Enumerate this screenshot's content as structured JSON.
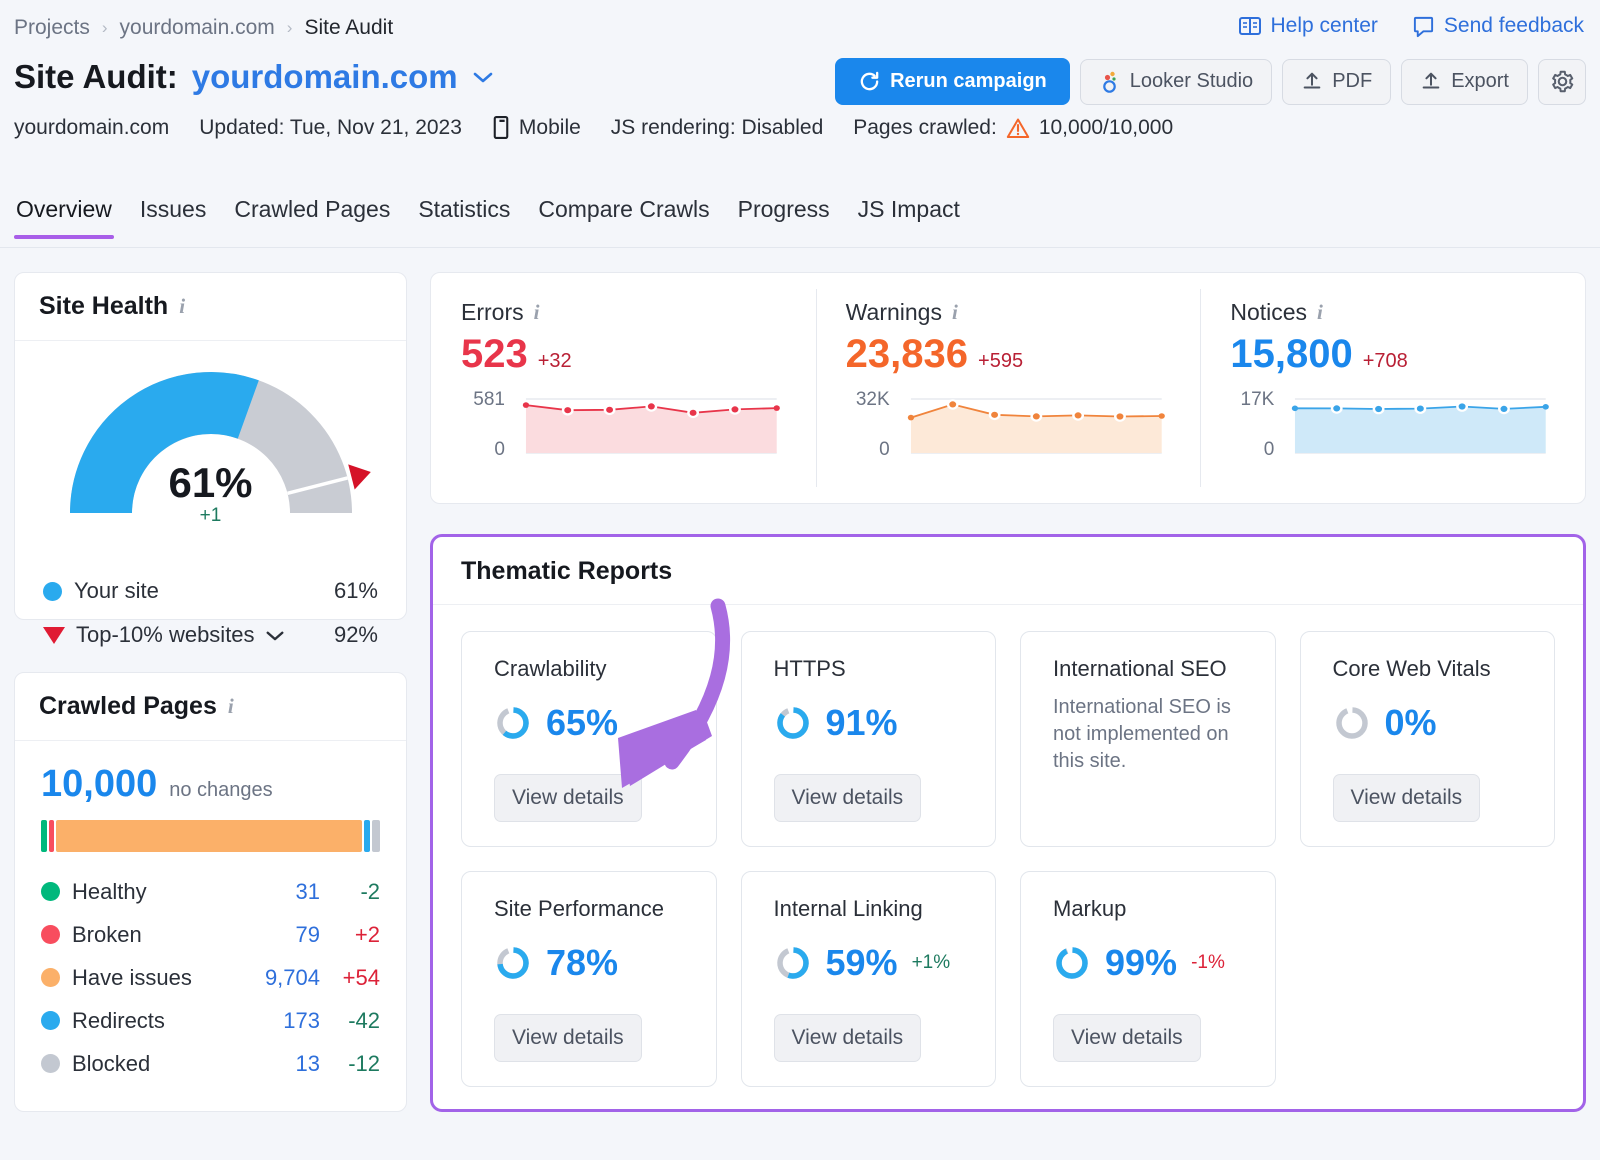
{
  "breadcrumb": {
    "items": [
      {
        "label": "Projects"
      },
      {
        "label": "yourdomain.com"
      },
      {
        "label": "Site Audit"
      }
    ],
    "separator": "›"
  },
  "top_links": [
    {
      "label": "Help center",
      "icon": "book-icon"
    },
    {
      "label": "Send feedback",
      "icon": "comment-icon"
    }
  ],
  "header": {
    "title_prefix": "Site Audit:",
    "domain": "yourdomain.com",
    "caret": "⌄"
  },
  "toolbar": {
    "rerun_label": "Rerun campaign",
    "looker_label": "Looker Studio",
    "pdf_label": "PDF",
    "export_label": "Export",
    "settings_icon": "gear-icon"
  },
  "meta": {
    "domain": "yourdomain.com",
    "updated": "Updated: Tue, Nov 21, 2023",
    "device": "Mobile",
    "js_rendering": "JS rendering: Disabled",
    "pages_crawled_label": "Pages crawled:",
    "pages_crawled_value": "10,000/10,000"
  },
  "tabs": [
    {
      "label": "Overview",
      "active": true
    },
    {
      "label": "Issues",
      "active": false
    },
    {
      "label": "Crawled Pages",
      "active": false
    },
    {
      "label": "Statistics",
      "active": false
    },
    {
      "label": "Compare Crawls",
      "active": false
    },
    {
      "label": "Progress",
      "active": false
    },
    {
      "label": "JS Impact",
      "active": false
    }
  ],
  "site_health": {
    "title": "Site Health",
    "info": "i",
    "value": "61%",
    "delta": "+1",
    "legend": [
      {
        "label": "Your site",
        "value": "61%",
        "marker": "dot",
        "color": "#2aaaee"
      },
      {
        "label": "Top-10% websites",
        "value": "92%",
        "marker": "triangle",
        "color": "#e01b33",
        "caret": "⌄"
      }
    ]
  },
  "crawled_pages": {
    "title": "Crawled Pages",
    "info": "i",
    "total": "10,000",
    "change_text": "no changes",
    "segments": [
      {
        "name": "Healthy",
        "color": "#00b87c",
        "pct": 1.6
      },
      {
        "name": "Broken",
        "color": "#f84d5e",
        "pct": 1.6
      },
      {
        "name": "Have issues",
        "color": "#fbb069",
        "pct": 87.8
      },
      {
        "name": "Redirects",
        "color": "#2aaaee",
        "pct": 1.8
      },
      {
        "name": "Blocked",
        "color": "#c3c8d1",
        "pct": 2.2
      }
    ],
    "rows": [
      {
        "label": "Healthy",
        "count": "31",
        "delta": "-2",
        "dir": "down",
        "color": "#00b87c"
      },
      {
        "label": "Broken",
        "count": "79",
        "delta": "+2",
        "dir": "up",
        "color": "#f84d5e"
      },
      {
        "label": "Have issues",
        "count": "9,704",
        "delta": "+54",
        "dir": "up",
        "color": "#fbb069"
      },
      {
        "label": "Redirects",
        "count": "173",
        "delta": "-42",
        "dir": "down",
        "color": "#2aaaee"
      },
      {
        "label": "Blocked",
        "count": "13",
        "delta": "-12",
        "dir": "down",
        "color": "#c3c8d1"
      }
    ]
  },
  "chart_data": [
    {
      "type": "line",
      "title": "Errors",
      "value": "523",
      "delta": "+32",
      "color": "#e8354a",
      "fill": "#fbdcdf",
      "ylabel_top": "581",
      "ylabel_bottom": "0",
      "ylim": [
        0,
        581
      ],
      "values": [
        560,
        500,
        505,
        545,
        470,
        510,
        525
      ]
    },
    {
      "type": "line",
      "title": "Warnings",
      "value": "23,836",
      "delta": "+595",
      "color": "#f0843c",
      "fill": "#fde9d8",
      "ylabel_top": "32K",
      "ylabel_bottom": "0",
      "ylim": [
        0,
        32000
      ],
      "values": [
        22800,
        31300,
        24600,
        23600,
        24200,
        23500,
        23836
      ]
    },
    {
      "type": "line",
      "title": "Notices",
      "value": "15,800",
      "delta": "+708",
      "color": "#3aa4e8",
      "fill": "#cfe9f9",
      "ylabel_top": "17K",
      "ylabel_bottom": "0",
      "ylim": [
        0,
        17000
      ],
      "values": [
        15300,
        15250,
        15050,
        15200,
        15900,
        15100,
        15800
      ]
    }
  ],
  "stats_info_icon": "i",
  "thematic": {
    "title": "Thematic Reports",
    "view_details_label": "View details",
    "cards": [
      {
        "name": "Crawlability",
        "pct": "65%",
        "value": 65,
        "delta": "",
        "delta_dir": "",
        "desc": ""
      },
      {
        "name": "HTTPS",
        "pct": "91%",
        "value": 91,
        "delta": "",
        "delta_dir": "",
        "desc": ""
      },
      {
        "name": "International SEO",
        "pct": "",
        "value": null,
        "delta": "",
        "delta_dir": "",
        "desc": "International SEO is not implemented on this site."
      },
      {
        "name": "Core Web Vitals",
        "pct": "0%",
        "value": 0,
        "delta": "",
        "delta_dir": "",
        "desc": ""
      },
      {
        "name": "Site Performance",
        "pct": "78%",
        "value": 78,
        "delta": "",
        "delta_dir": "",
        "desc": ""
      },
      {
        "name": "Internal Linking",
        "pct": "59%",
        "value": 59,
        "delta": "+1%",
        "delta_dir": "up",
        "desc": ""
      },
      {
        "name": "Markup",
        "pct": "99%",
        "value": 99,
        "delta": "-1%",
        "delta_dir": "down",
        "desc": ""
      }
    ]
  },
  "colors": {
    "accent_blue": "#1a87ec",
    "annotation_purple": "#a96ee0",
    "highlight_border": "#a263e8",
    "error_red": "#e8354a",
    "warning_orange": "#f4662a",
    "notice_blue": "#1a87ec",
    "positive_green": "#1d7a5f",
    "negative_red": "#dc2238"
  }
}
